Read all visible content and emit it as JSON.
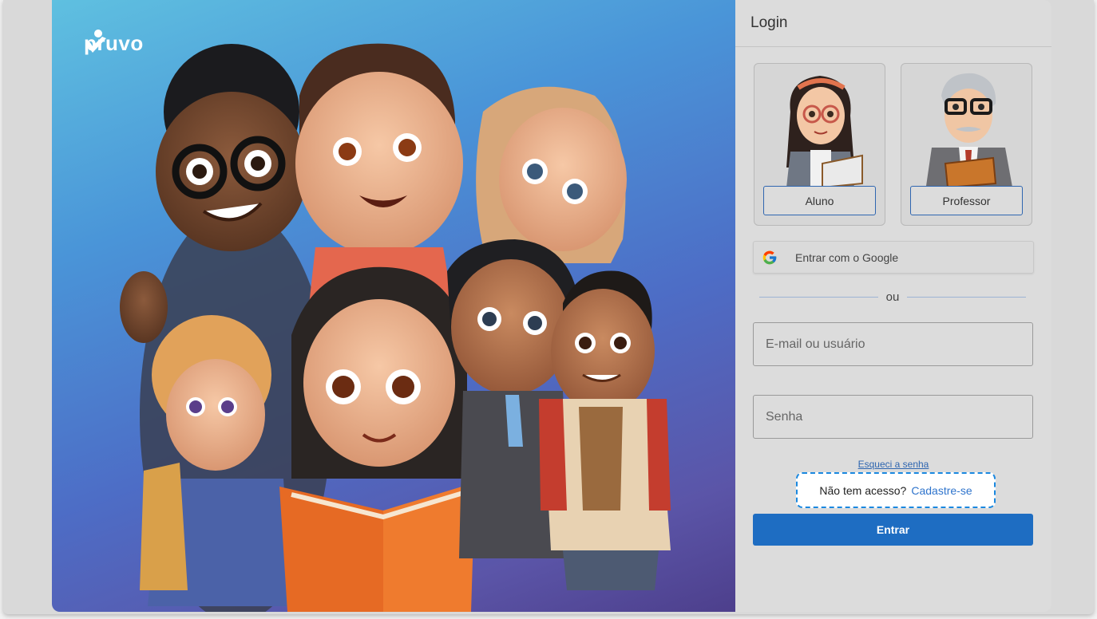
{
  "brand": {
    "name": "pruvo"
  },
  "login": {
    "title": "Login",
    "roles": [
      {
        "label": "Aluno"
      },
      {
        "label": "Professor"
      }
    ],
    "google_label": "Entrar com o Google",
    "divider_text": "ou",
    "email_placeholder": "E-mail ou usuário",
    "password_placeholder": "Senha",
    "forgot_label": "Esqueci a senha",
    "signup_prompt": "Não tem acesso?",
    "signup_link": "Cadastre-se",
    "submit_label": "Entrar"
  },
  "colors": {
    "primary": "#1e6dc2",
    "link": "#2f74cc",
    "focus_dash": "#1a88e0"
  },
  "icons": {
    "google": "google-g-icon",
    "logo": "pruvo-check-logo-icon"
  }
}
